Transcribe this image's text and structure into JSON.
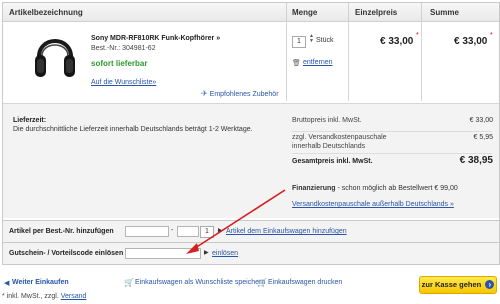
{
  "table": {
    "headers": {
      "article": "Artikelbezeichnung",
      "qty": "Menge",
      "unit_price": "Einzelpreis",
      "sum": "Summe"
    }
  },
  "item": {
    "name": "Sony MDR-RF810RK Funk-Kopfhörer »",
    "article_no": "Best.-Nr.: 304981-62",
    "availability": "sofort lieferbar",
    "wishlist": "Auf die Wunschliste»",
    "recommended": "Empfohlenes Zubehör",
    "qty_value": "1",
    "qty_unit": "Stück",
    "remove": "entfernen",
    "unit_price": "€ 33,00",
    "sum": "€ 33,00",
    "star": "*"
  },
  "delivery": {
    "title": "Lieferzeit:",
    "text": "Die durchschnittliche Lieferzeit innerhalb Deutschlands beträgt 1-2 Werktage."
  },
  "totals": {
    "gross_label": "Bruttopreis inkl. MwSt.",
    "gross_value": "€ 33,00",
    "shipping_label_1": "zzgl. Versandkostenpauschale",
    "shipping_label_2": "innerhalb Deutschlands",
    "shipping_value": "€ 5,95",
    "total_label": "Gesamtpreis inkl. MwSt.",
    "total_value": "€ 38,95",
    "financing_bold": "Finanzierung",
    "financing_text": " - schon möglich ab Bestellwert € 99,00",
    "shipping_link": "Versandkostenpauschale außerhalb Deutschlands »"
  },
  "add_article": {
    "label": "Artikel per Best.-Nr. hinzufügen",
    "dash": "-",
    "qty": "1",
    "link": "Artikel dem Einkaufswagen hinzufügen"
  },
  "voucher": {
    "label": "Gutschein- / Vorteilscode einlösen",
    "link": "einlösen"
  },
  "footer": {
    "continue": "Weiter Einkaufen",
    "save_wishlist": "Einkaufswagen als Wunschliste speichern",
    "print": "Einkaufswagen drucken",
    "checkout": "zur Kasse gehen",
    "checkout_arrow": "›",
    "note_prefix": "* inkl. MwSt., zzgl. ",
    "note_link": "Versand"
  },
  "colors": {
    "accent_link": "#2a55a8",
    "availability": "#2e9a2e",
    "price_star": "#e2001a",
    "checkout": "#f7c600",
    "annotation_arrow": "#d42020"
  }
}
